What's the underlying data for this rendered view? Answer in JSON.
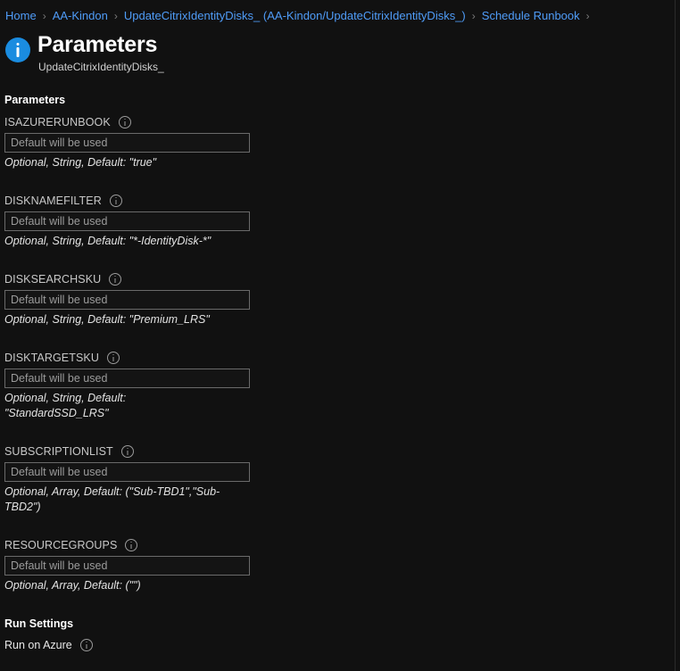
{
  "breadcrumb": {
    "separator": "›",
    "items": [
      {
        "label": "Home"
      },
      {
        "label": "AA-Kindon"
      },
      {
        "label": "UpdateCitrixIdentityDisks_ (AA-Kindon/UpdateCitrixIdentityDisks_)"
      },
      {
        "label": "Schedule Runbook"
      }
    ],
    "trailing_separator": "›"
  },
  "header": {
    "icon": "info-circle-icon",
    "title": "Parameters",
    "subtitle": "UpdateCitrixIdentityDisks_"
  },
  "form": {
    "section_title": "Parameters",
    "info_icon": "info-icon",
    "parameters": [
      {
        "name": "ISAZURERUNBOOK",
        "value": "",
        "placeholder": "Default will be used",
        "hint": "Optional, String, Default: \"true\""
      },
      {
        "name": "DISKNAMEFILTER",
        "value": "",
        "placeholder": "Default will be used",
        "hint": "Optional, String, Default: \"*-IdentityDisk-*\""
      },
      {
        "name": "DISKSEARCHSKU",
        "value": "",
        "placeholder": "Default will be used",
        "hint": "Optional, String, Default: \"Premium_LRS\""
      },
      {
        "name": "DISKTARGETSKU",
        "value": "",
        "placeholder": "Default will be used",
        "hint": "Optional, String, Default: \"StandardSSD_LRS\""
      },
      {
        "name": "SUBSCRIPTIONLIST",
        "value": "",
        "placeholder": "Default will be used",
        "hint": "Optional, Array, Default: (\"Sub-TBD1\",\"Sub-TBD2\")"
      },
      {
        "name": "RESOURCEGROUPS",
        "value": "",
        "placeholder": "Default will be used",
        "hint": "Optional, Array, Default: (\"\")"
      }
    ]
  },
  "run_settings": {
    "title": "Run Settings",
    "option_label": "Run on Azure",
    "info_icon": "info-icon"
  },
  "colors": {
    "background": "#111111",
    "link": "#4f9cf8",
    "accent_icon": "#1a8ce0",
    "input_border": "#6a6a6a",
    "label": "#c8c8c8",
    "hint": "#e3e3e3"
  }
}
